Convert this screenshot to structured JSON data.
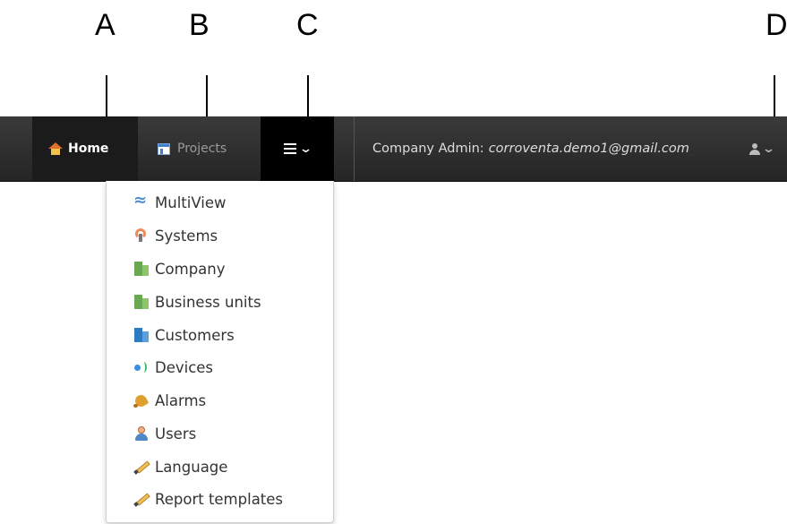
{
  "callouts": [
    "A",
    "B",
    "C",
    "D"
  ],
  "navbar": {
    "home_label": "Home",
    "projects_label": "Projects",
    "admin_label": "Company Admin:",
    "admin_email": "corroventa.demo1@gmail.com"
  },
  "dropdown": {
    "items": [
      {
        "label": "MultiView",
        "icon": "multiview-icon"
      },
      {
        "label": "Systems",
        "icon": "systems-icon"
      },
      {
        "label": "Company",
        "icon": "company-icon"
      },
      {
        "label": "Business units",
        "icon": "business-units-icon"
      },
      {
        "label": "Customers",
        "icon": "customers-icon"
      },
      {
        "label": "Devices",
        "icon": "devices-icon"
      },
      {
        "label": "Alarms",
        "icon": "alarms-icon"
      },
      {
        "label": "Users",
        "icon": "users-icon"
      },
      {
        "label": "Language",
        "icon": "pencil-icon"
      },
      {
        "label": "Report templates",
        "icon": "pencil-icon"
      }
    ]
  },
  "colors": {
    "navbar_bg": "#2e2e2e",
    "active_tab_bg": "#1b1b1b",
    "menu_toggle_bg": "#000000"
  }
}
